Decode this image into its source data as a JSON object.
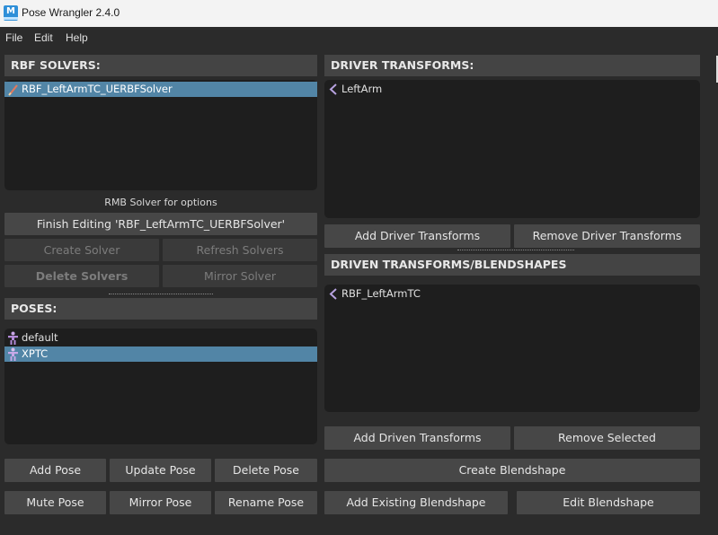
{
  "window": {
    "title": "Pose Wrangler 2.4.0",
    "logo_letter": "M"
  },
  "menu": {
    "items": [
      "File",
      "Edit",
      "Help"
    ]
  },
  "rbf_solvers": {
    "header": "RBF SOLVERS:",
    "items": [
      {
        "label": "RBF_LeftArmTC_UERBFSolver",
        "selected": true
      }
    ],
    "hint": "RMB Solver for options",
    "finish_editing_label": "Finish Editing 'RBF_LeftArmTC_UERBFSolver'",
    "create_solver_label": "Create Solver",
    "refresh_solvers_label": "Refresh Solvers",
    "delete_solvers_label": "Delete Solvers",
    "mirror_solver_label": "Mirror Solver"
  },
  "poses": {
    "header": "POSES:",
    "items": [
      {
        "label": "default",
        "selected": false
      },
      {
        "label": "XPTC",
        "selected": true
      }
    ],
    "add_label": "Add Pose",
    "update_label": "Update Pose",
    "delete_label": "Delete Pose",
    "mute_label": "Mute Pose",
    "mirror_label": "Mirror Pose",
    "rename_label": "Rename Pose"
  },
  "driver_transforms": {
    "header": "DRIVER TRANSFORMS:",
    "items": [
      {
        "label": "LeftArm"
      }
    ],
    "add_label": "Add Driver Transforms",
    "remove_label": "Remove Driver Transforms"
  },
  "driven_transforms": {
    "header": "DRIVEN TRANSFORMS/BLENDSHAPES",
    "items": [
      {
        "label": "RBF_LeftArmTC"
      }
    ],
    "add_label": "Add Driven Transforms",
    "remove_label": "Remove Selected"
  },
  "blendshape": {
    "create_label": "Create Blendshape",
    "add_existing_label": "Add Existing Blendshape",
    "edit_label": "Edit Blendshape"
  },
  "colors": {
    "background": "#2b2b2b",
    "list_background": "#1e1e1e",
    "selection": "#5285a6",
    "button": "#474747",
    "header": "#444444",
    "title_bar": "#f3f3f3",
    "logo": "#2e8fd8"
  },
  "icons": {
    "solver": "solver-pencil-icon",
    "pose": "pose-figure-icon",
    "transform": "transform-chevron-icon"
  }
}
